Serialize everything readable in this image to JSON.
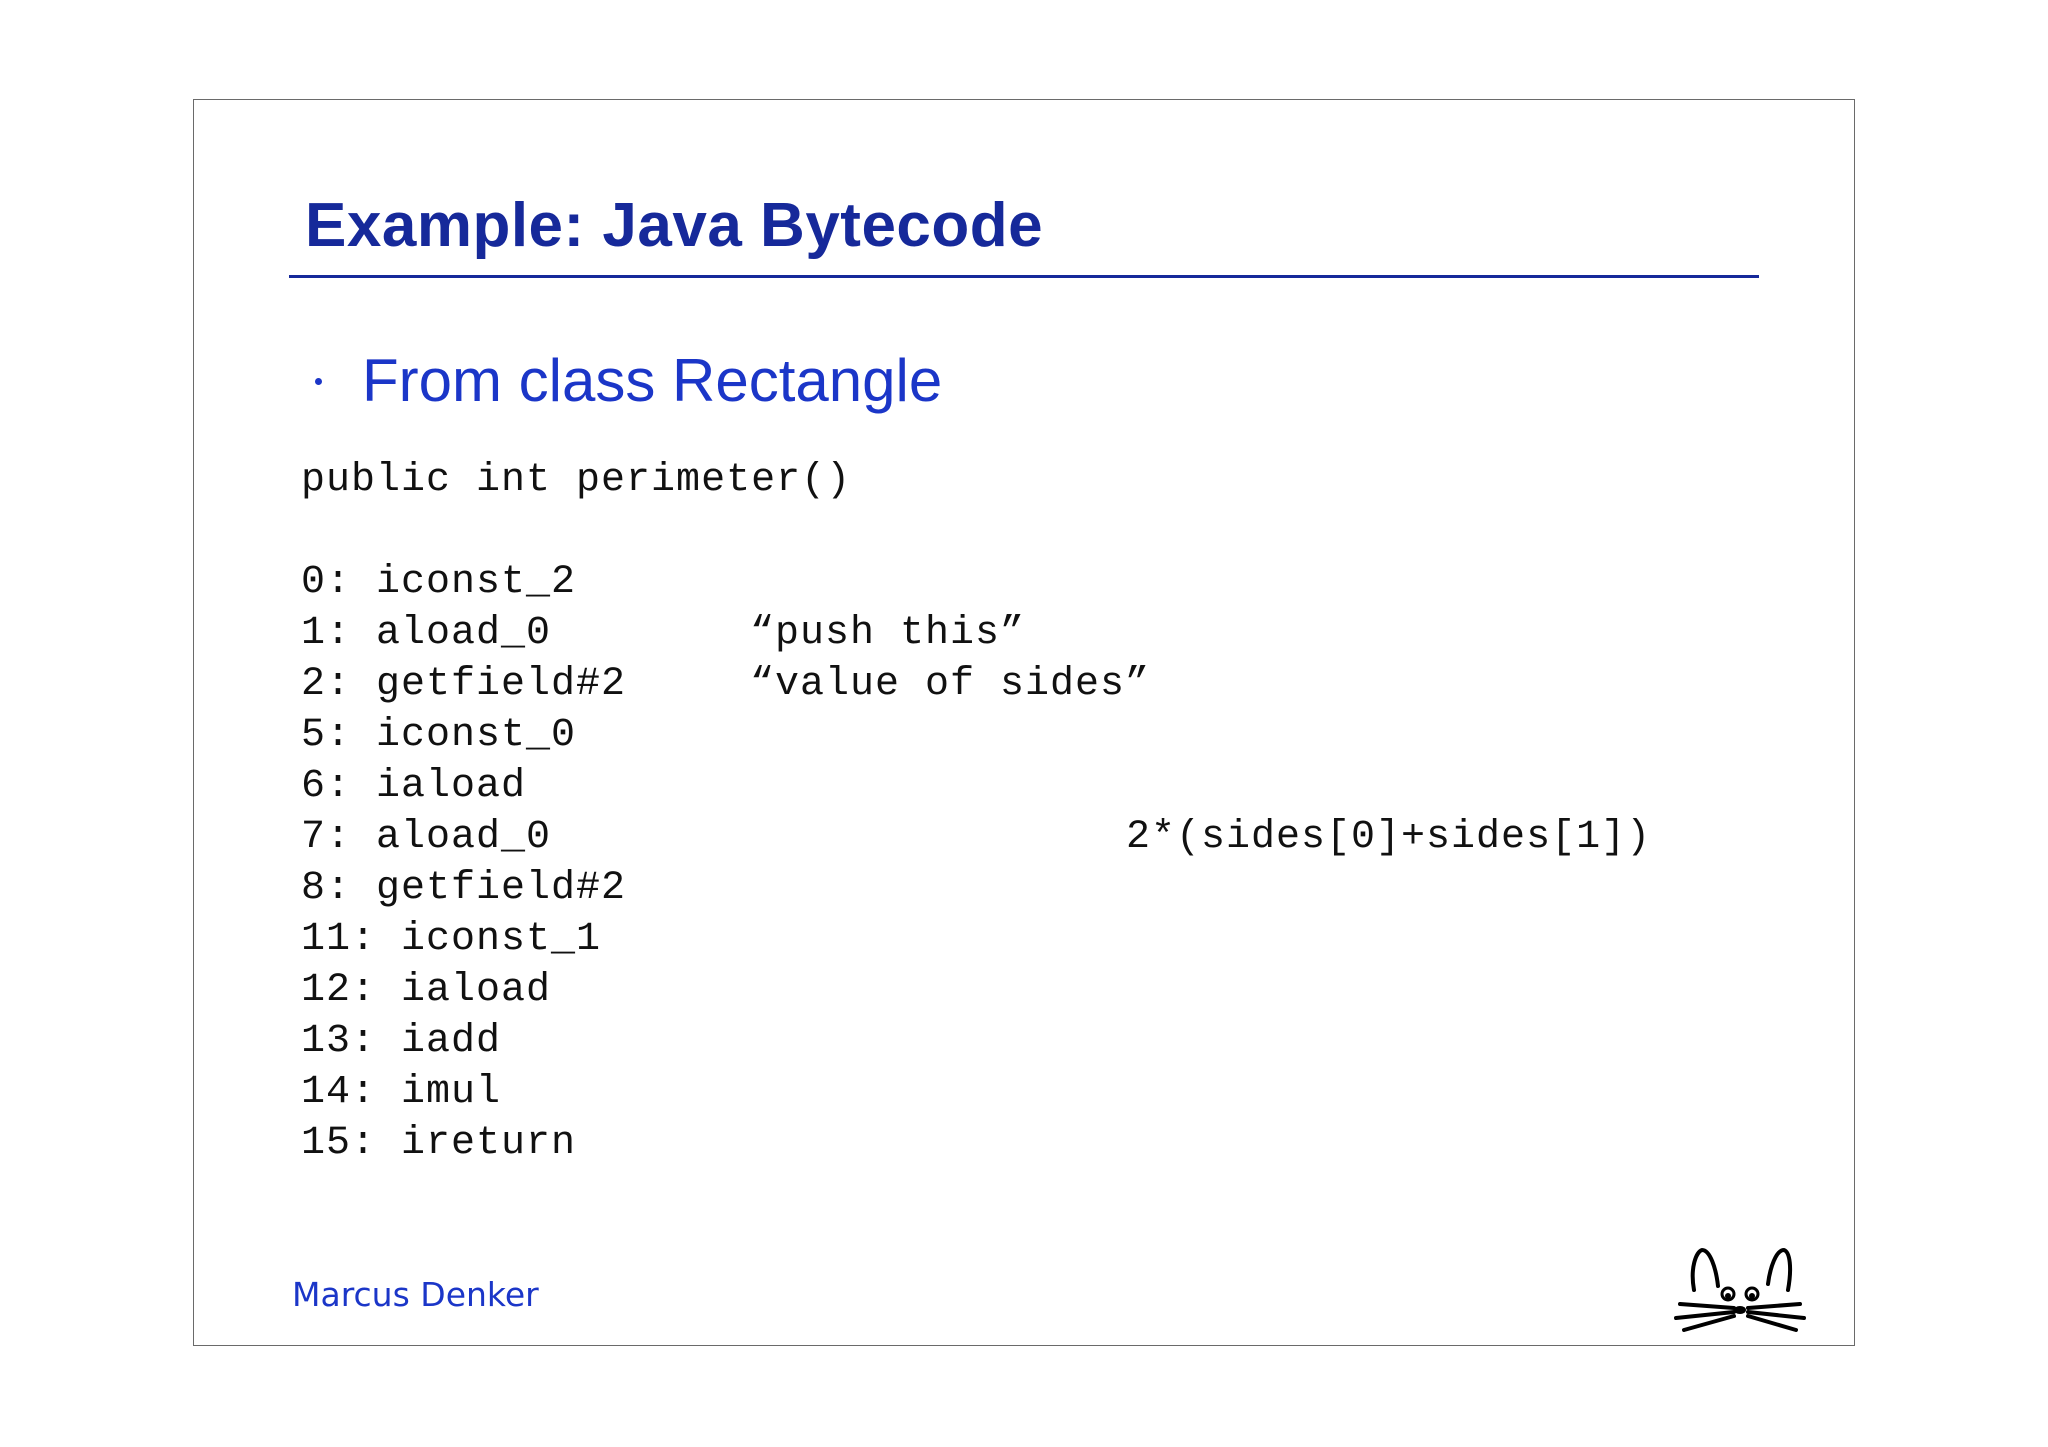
{
  "slide": {
    "title": "Example: Java Bytecode",
    "bullet": "From class Rectangle",
    "method_signature": "public int perimeter()",
    "instructions": [
      "0: iconst_2",
      "1: aload_0",
      "2: getfield#2",
      "5: iconst_0",
      "6: iaload",
      "7: aload_0",
      "8: getfield#2",
      "11: iconst_1",
      "12: iaload",
      "13: iadd",
      "14: imul",
      "15: ireturn"
    ],
    "comments": {
      "push_this": "“push this”",
      "value_of_sides": "“value of sides”",
      "expression": "2*(sides[0]+sides[1])"
    },
    "author": "Marcus Denker",
    "logo_icon": "cat-face-logo-icon"
  },
  "colors": {
    "title": "#16299a",
    "bullet": "#1b36c8",
    "code": "#111111",
    "border": "#6a6a6a"
  }
}
